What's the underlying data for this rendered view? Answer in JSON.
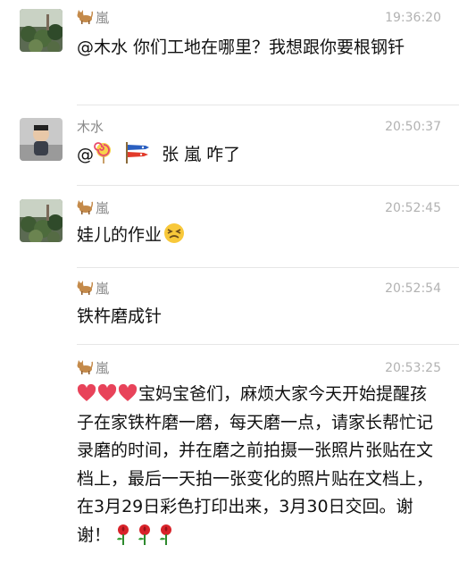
{
  "messages": [
    {
      "sender": "嵐",
      "time": "19:36:20",
      "text": "@木水 你们工地在哪里？我想跟你要根钢钎"
    },
    {
      "sender": "木水",
      "time": "20:50:37",
      "text_prefix": "@",
      "text_suffix": "张 嵐 咋了"
    },
    {
      "sender": "嵐",
      "time": "20:52:45",
      "text": "娃儿的作业"
    },
    {
      "sender": "嵐",
      "time": "20:52:54",
      "text": "铁杵磨成针"
    },
    {
      "sender": "嵐",
      "time": "20:53:25",
      "text": "宝妈宝爸们，麻烦大家今天开始提醒孩子在家铁杵磨一磨，每天磨一点，请家长帮忙记录磨的时间，并在磨之前拍摄一张照片张贴在文档上，最后一天拍一张变化的照片贴在文档上，在3月29日彩色打印出来，3月30日交回。谢谢！"
    }
  ],
  "icons": {
    "cat": "cat-icon",
    "lollipop": "lollipop-icon",
    "carp_flag": "carp-streamer-icon",
    "persevering_face": "persevering-face-icon",
    "heart": "heart-icon",
    "rose": "rose-icon"
  },
  "colors": {
    "name": "#8a8a8a",
    "time": "#b2b2b2",
    "divider": "#e6e6e6",
    "heart": "#e8435a",
    "rose": "#d8232a"
  }
}
